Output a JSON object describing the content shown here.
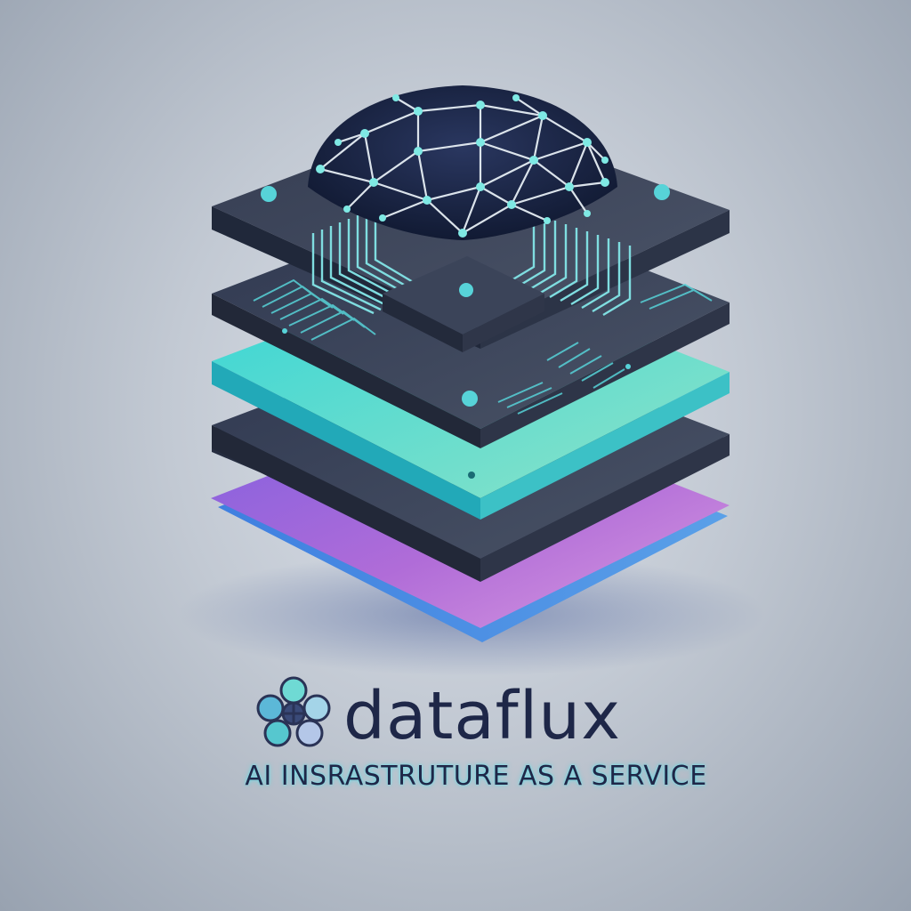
{
  "brand": {
    "name": "dataflux",
    "tagline": "AI INSRASTRUTURE AS A SERVICE",
    "logo_icon": "neural-cluster-icon"
  },
  "illustration": {
    "subject": "stacked-layer-cube-icon",
    "top_element": "neural-network-dome-icon",
    "layer_count": 5
  },
  "colors": {
    "background": "#c2c9d3",
    "chip_dark": "#3a4356",
    "accent_teal": "#3ed6d0",
    "layer_purple": "#a06ad8",
    "layer_blue": "#4f7cd8",
    "text_dark": "#1e2748"
  }
}
